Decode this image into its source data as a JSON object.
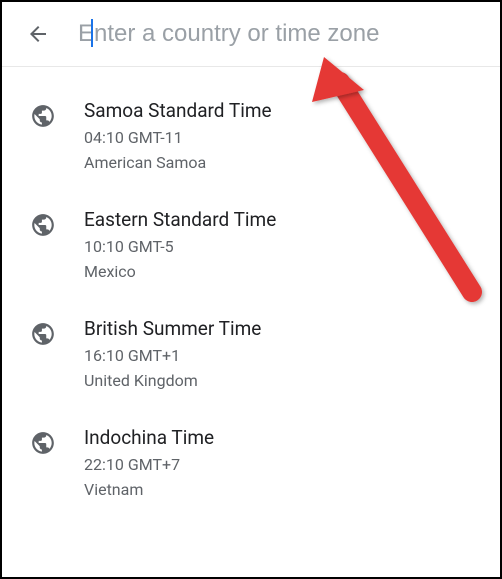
{
  "search": {
    "placeholder": "Enter a country or time zone",
    "value": ""
  },
  "timezones": [
    {
      "name": "Samoa Standard Time",
      "time": "04:10  GMT-11",
      "country": "American Samoa"
    },
    {
      "name": "Eastern Standard Time",
      "time": "10:10  GMT-5",
      "country": "Mexico"
    },
    {
      "name": "British Summer Time",
      "time": "16:10  GMT+1",
      "country": "United Kingdom"
    },
    {
      "name": "Indochina Time",
      "time": "22:10  GMT+7",
      "country": "Vietnam"
    }
  ]
}
